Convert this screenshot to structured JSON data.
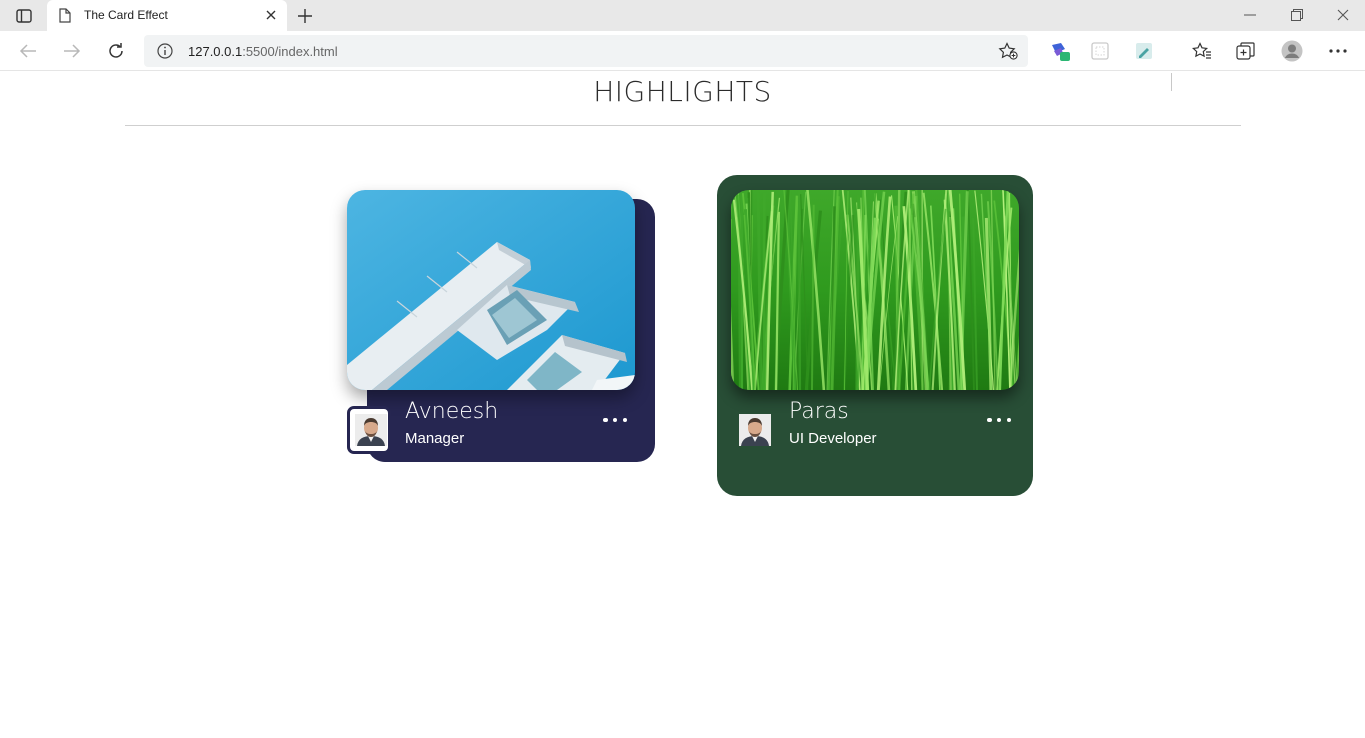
{
  "browser": {
    "tab_title": "The Card Effect",
    "url_host": "127.0.0.1",
    "url_rest": ":5500/index.html"
  },
  "page": {
    "title": "HIGHLIGHTS"
  },
  "cards": [
    {
      "name": "Avneesh",
      "role": "Manager",
      "theme_color": "#262651",
      "image": "white-architecture-against-blue-sky"
    },
    {
      "name": "Paras",
      "role": "UI Developer",
      "theme_color": "#284e36",
      "image": "green-grass-field"
    }
  ],
  "icons": {
    "tab": "page-icon",
    "close": "close-icon",
    "new_tab": "plus-icon",
    "back": "back-arrow-icon",
    "forward": "forward-arrow-icon",
    "reload": "reload-icon",
    "info": "info-icon",
    "favorite": "add-favorite-icon",
    "more": "ellipsis-icon"
  }
}
